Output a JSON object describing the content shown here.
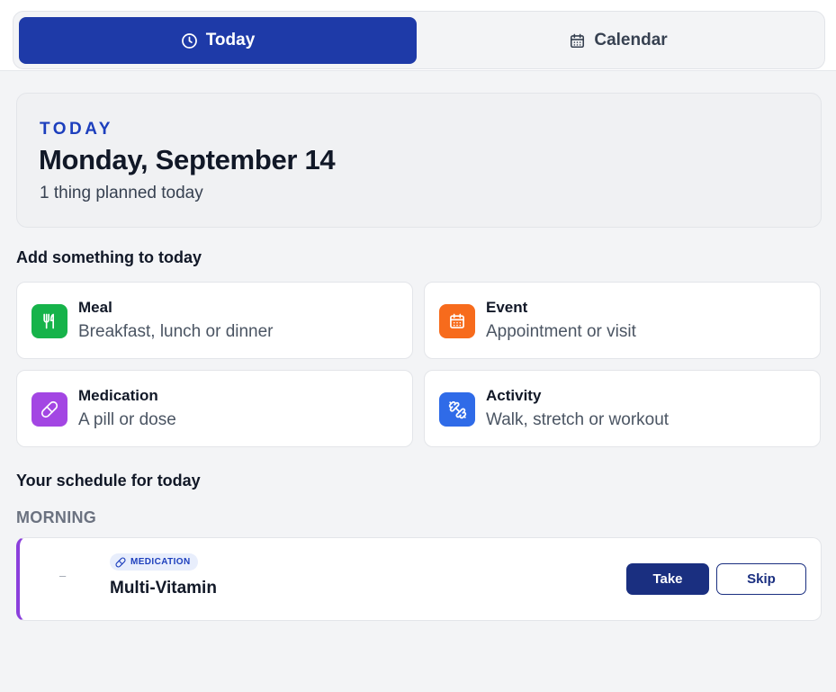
{
  "tabs": [
    {
      "label": "Today",
      "icon": "clock-icon",
      "active": true
    },
    {
      "label": "Calendar",
      "icon": "calendar-icon",
      "active": false
    }
  ],
  "hero": {
    "eyebrow": "TODAY",
    "date": "Monday, September 14",
    "summary": "1 thing planned today"
  },
  "add_section": {
    "title": "Add something to today",
    "items": [
      {
        "title": "Meal",
        "description": "Breakfast, lunch or dinner",
        "icon": "utensils-icon",
        "color": "#16b34a"
      },
      {
        "title": "Event",
        "description": "Appointment or visit",
        "icon": "calendar-icon",
        "color": "#f76b1c"
      },
      {
        "title": "Medication",
        "description": "A pill or dose",
        "icon": "pill-icon",
        "color": "#a346e3"
      },
      {
        "title": "Activity",
        "description": "Walk, stretch or workout",
        "icon": "dumbbell-icon",
        "color": "#2f6be8"
      }
    ]
  },
  "schedule": {
    "title": "Your schedule for today",
    "period": "MORNING",
    "items": [
      {
        "time": "–",
        "badge": "MEDICATION",
        "badge_icon": "pill-icon",
        "name": "Multi-Vitamin",
        "accent": "#8b3fdc",
        "take_label": "Take",
        "skip_label": "Skip"
      }
    ]
  },
  "colors": {
    "primary": "#1e3aa8",
    "button_dark": "#1a2f80",
    "eyebrow": "#1d3fbd",
    "background": "#f3f4f6"
  }
}
